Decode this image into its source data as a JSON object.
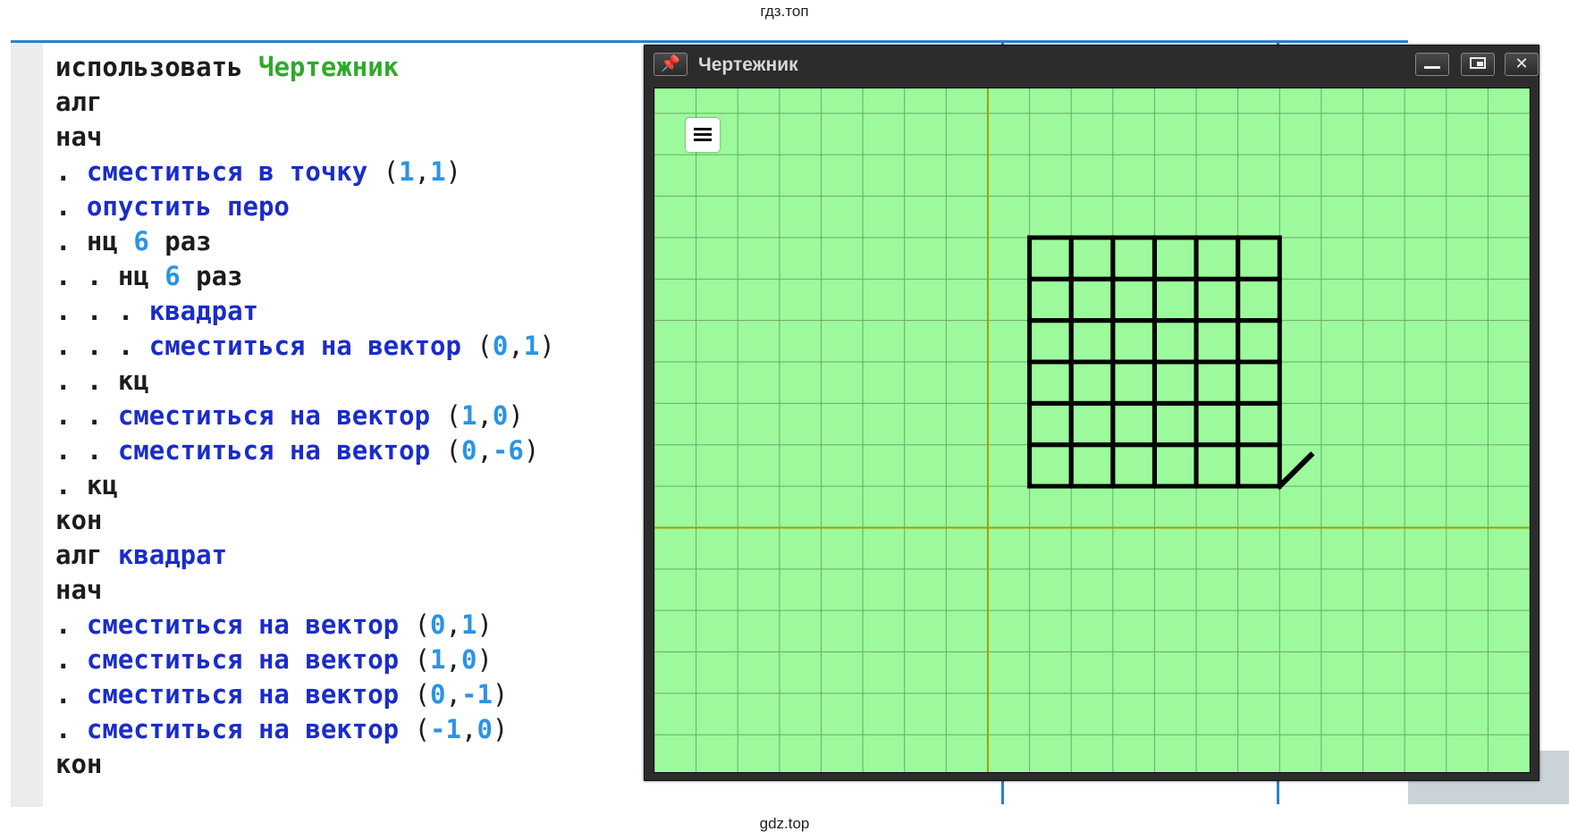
{
  "watermark": {
    "top": "гдз.топ",
    "bottom": "gdz.top"
  },
  "code": {
    "lines": [
      [
        {
          "t": "использовать ",
          "c": "kw"
        },
        {
          "t": "Чертежник",
          "c": "mod"
        }
      ],
      [
        {
          "t": "алг",
          "c": "kw"
        }
      ],
      [
        {
          "t": "нач",
          "c": "kw"
        }
      ],
      [
        {
          "t": ". ",
          "c": "dot"
        },
        {
          "t": "сместиться в точку ",
          "c": "cmd"
        },
        {
          "t": "(",
          "c": "punc"
        },
        {
          "t": "1",
          "c": "num"
        },
        {
          "t": ",",
          "c": "punc"
        },
        {
          "t": "1",
          "c": "num"
        },
        {
          "t": ")",
          "c": "punc"
        }
      ],
      [
        {
          "t": ". ",
          "c": "dot"
        },
        {
          "t": "опустить перо",
          "c": "cmd"
        }
      ],
      [
        {
          "t": ". ",
          "c": "dot"
        },
        {
          "t": "нц ",
          "c": "kw"
        },
        {
          "t": "6",
          "c": "num"
        },
        {
          "t": " раз",
          "c": "kw"
        }
      ],
      [
        {
          "t": ". . ",
          "c": "dot"
        },
        {
          "t": "нц ",
          "c": "kw"
        },
        {
          "t": "6",
          "c": "num"
        },
        {
          "t": " раз",
          "c": "kw"
        }
      ],
      [
        {
          "t": ". . . ",
          "c": "dot"
        },
        {
          "t": "квадрат",
          "c": "cmd"
        }
      ],
      [
        {
          "t": ". . . ",
          "c": "dot"
        },
        {
          "t": "сместиться на вектор ",
          "c": "cmd"
        },
        {
          "t": "(",
          "c": "punc"
        },
        {
          "t": "0",
          "c": "num"
        },
        {
          "t": ",",
          "c": "punc"
        },
        {
          "t": "1",
          "c": "num"
        },
        {
          "t": ")",
          "c": "punc"
        }
      ],
      [
        {
          "t": ". . ",
          "c": "dot"
        },
        {
          "t": "кц",
          "c": "kw"
        }
      ],
      [
        {
          "t": ". . ",
          "c": "dot"
        },
        {
          "t": "сместиться на вектор ",
          "c": "cmd"
        },
        {
          "t": "(",
          "c": "punc"
        },
        {
          "t": "1",
          "c": "num"
        },
        {
          "t": ",",
          "c": "punc"
        },
        {
          "t": "0",
          "c": "num"
        },
        {
          "t": ")",
          "c": "punc"
        }
      ],
      [
        {
          "t": ". . ",
          "c": "dot"
        },
        {
          "t": "сместиться на вектор ",
          "c": "cmd"
        },
        {
          "t": "(",
          "c": "punc"
        },
        {
          "t": "0",
          "c": "num"
        },
        {
          "t": ",",
          "c": "punc"
        },
        {
          "t": "-6",
          "c": "num"
        },
        {
          "t": ")",
          "c": "punc"
        }
      ],
      [
        {
          "t": ". ",
          "c": "dot"
        },
        {
          "t": "кц",
          "c": "kw"
        }
      ],
      [
        {
          "t": "кон",
          "c": "kw"
        }
      ],
      [
        {
          "t": "алг ",
          "c": "kw"
        },
        {
          "t": "квадрат",
          "c": "cmd"
        }
      ],
      [
        {
          "t": "нач",
          "c": "kw"
        }
      ],
      [
        {
          "t": ". ",
          "c": "dot"
        },
        {
          "t": "сместиться на вектор ",
          "c": "cmd"
        },
        {
          "t": "(",
          "c": "punc"
        },
        {
          "t": "0",
          "c": "num"
        },
        {
          "t": ",",
          "c": "punc"
        },
        {
          "t": "1",
          "c": "num"
        },
        {
          "t": ")",
          "c": "punc"
        }
      ],
      [
        {
          "t": ". ",
          "c": "dot"
        },
        {
          "t": "сместиться на вектор ",
          "c": "cmd"
        },
        {
          "t": "(",
          "c": "punc"
        },
        {
          "t": "1",
          "c": "num"
        },
        {
          "t": ",",
          "c": "punc"
        },
        {
          "t": "0",
          "c": "num"
        },
        {
          "t": ")",
          "c": "punc"
        }
      ],
      [
        {
          "t": ". ",
          "c": "dot"
        },
        {
          "t": "сместиться на вектор ",
          "c": "cmd"
        },
        {
          "t": "(",
          "c": "punc"
        },
        {
          "t": "0",
          "c": "num"
        },
        {
          "t": ",",
          "c": "punc"
        },
        {
          "t": "-1",
          "c": "num"
        },
        {
          "t": ")",
          "c": "punc"
        }
      ],
      [
        {
          "t": ". ",
          "c": "dot"
        },
        {
          "t": "сместиться на вектор ",
          "c": "cmd"
        },
        {
          "t": "(",
          "c": "punc"
        },
        {
          "t": "-1",
          "c": "num"
        },
        {
          "t": ",",
          "c": "punc"
        },
        {
          "t": "0",
          "c": "num"
        },
        {
          "t": ")",
          "c": "punc"
        }
      ],
      [
        {
          "t": "кон",
          "c": "kw"
        }
      ]
    ]
  },
  "window": {
    "title": "Чертежник",
    "icons": {
      "pin": "pin-icon",
      "minimize": "minimize-icon",
      "restore": "restore-icon",
      "close": "close-icon",
      "menu": "hamburger-menu-icon"
    }
  },
  "drawing": {
    "x_range": [
      -8,
      13
    ],
    "y_range": [
      -5.9,
      10.6
    ],
    "background": "#9cfa9c",
    "grid_color": "#6ea86e",
    "axis_color": "#a0a000",
    "pen_color": "#000000",
    "squares": {
      "origin": [
        1,
        1
      ],
      "cols": 6,
      "rows": 6,
      "size": 1
    },
    "pen_stroke": {
      "from": [
        7,
        1
      ],
      "to": [
        7.75,
        1.75
      ]
    }
  }
}
